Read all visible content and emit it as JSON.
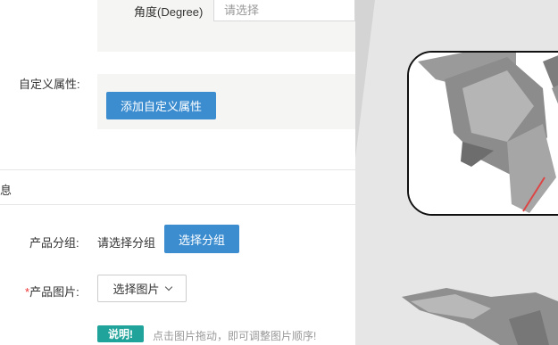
{
  "attributes": {
    "degree_label": "角度(Degree)",
    "degree_placeholder": "请选择",
    "custom_label": "自定义属性:",
    "add_custom_button": "添加自定义属性"
  },
  "section": {
    "title_fragment": "息"
  },
  "product": {
    "group_label": "产品分组:",
    "group_value": "请选择分组",
    "choose_group_button": "选择分组",
    "image_required_mark": "*",
    "image_label": "产品图片:",
    "image_select_label": "选择图片",
    "note_badge": "说明!",
    "note_text": "点击图片拖动，即可调整图片顺序!"
  },
  "colors": {
    "accent": "#3c8dd0",
    "badge": "#1fa39a",
    "panel": "#f5f5f3"
  }
}
